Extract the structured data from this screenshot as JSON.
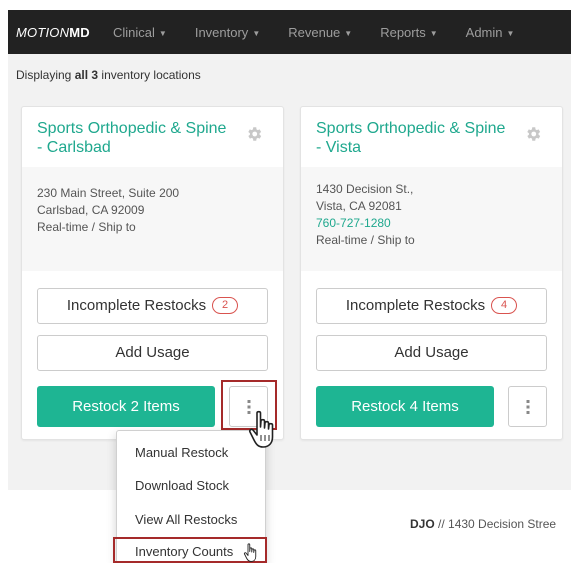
{
  "navbar": {
    "brand_prefix": "MOTION",
    "brand_suffix": "MD",
    "items": [
      {
        "label": "Clinical"
      },
      {
        "label": "Inventory"
      },
      {
        "label": "Revenue"
      },
      {
        "label": "Reports"
      },
      {
        "label": "Admin"
      }
    ]
  },
  "summary": {
    "prefix": "Displaying ",
    "count": "all 3",
    "suffix": " inventory locations"
  },
  "locations": [
    {
      "title": "Sports Orthopedic & Spine - Carlsbad",
      "address_line1": "230 Main Street, Suite 200",
      "address_line2": "Carlsbad, CA 92009",
      "mode": "Real-time / Ship to",
      "incomplete_label": "Incomplete Restocks",
      "incomplete_count": "2",
      "usage_label": "Add Usage",
      "restock_label": "Restock 2 Items"
    },
    {
      "title": "Sports Orthopedic & Spine - Vista",
      "address_line1": "1430 Decision St.,",
      "address_line2": "Vista, CA 92081",
      "phone": "760-727-1280",
      "mode": "Real-time / Ship to",
      "incomplete_label": "Incomplete Restocks",
      "incomplete_count": "4",
      "usage_label": "Add Usage",
      "restock_label": "Restock 4 Items"
    }
  ],
  "dropdown": {
    "items": [
      {
        "label": "Manual Restock"
      },
      {
        "label": "Download Stock"
      },
      {
        "label": "View All Restocks"
      },
      {
        "label": "Inventory Counts"
      }
    ]
  },
  "footer": {
    "company": "DJO",
    "text": " // 1430 Decision Stree"
  },
  "colors": {
    "navbar": "#222222",
    "accent_teal": "#1fa88e",
    "primary_button": "#1eb593",
    "badge_red": "#d9534f",
    "highlight_box": "#a52a2a"
  },
  "icons": {
    "location_settings": "gear-icon",
    "more_actions": "vertical-ellipsis-icon",
    "pointer": "hand-cursor-icon"
  }
}
